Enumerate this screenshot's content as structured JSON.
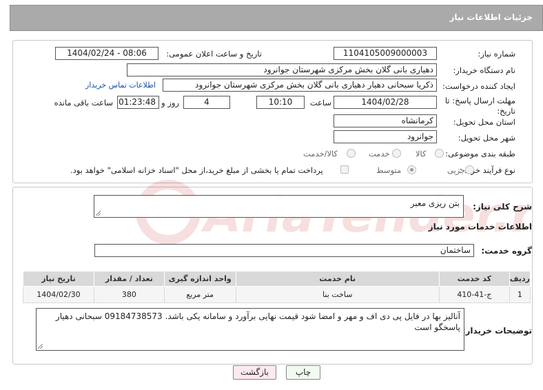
{
  "header": {
    "title": "جزئیات اطلاعات نیاز"
  },
  "labels": {
    "need_number": "شماره نیاز:",
    "announce_datetime": "تاریخ و ساعت اعلان عمومی:",
    "buyer_org": "نام دستگاه خریدار:",
    "requester": "ایجاد کننده درخواست:",
    "deadline": "مهلت ارسال پاسخ: تا تاریخ:",
    "time_word": "ساعت",
    "day_word": "روز و",
    "remaining_word": "ساعت باقی مانده",
    "province": "استان محل تحویل:",
    "city": "شهر محل تحویل:",
    "category": "طبقه بندی موضوعی:",
    "process_type": "نوع فرآیند خرید :",
    "need_desc": "شرح کلی نیاز:",
    "services_info": "اطلاعات خدمات مورد نیاز",
    "service_group": "گروه خدمت:",
    "buyer_notes": "توضیحات خریدار:"
  },
  "fields": {
    "need_number": "1104105009000003",
    "announce_datetime": "1404/02/24 - 08:06",
    "buyer_org": "دهیاری بانی گلان بخش مرکزی شهرستان جوانرود",
    "requester": "ذکریا سبحانی دهیار دهیاری بانی گلان بخش مرکزی شهرستان جوانرود",
    "contact_link": "اطلاعات تماس خریدار",
    "deadline_date": "1404/02/28",
    "deadline_time": "10:10",
    "days_left": "4",
    "time_left": "01:23:48",
    "province": "کرمانشاه",
    "city": "جوانرود",
    "need_desc": "بتن ریزی معبر",
    "service_group": "ساختمان",
    "buyer_notes": "آنالیز بها در فایل پی دی اف و مهر و امضا شود قیمت نهایی برآورد و سامانه یکی باشد. 09184738573 سبحانی دهیار پاسخگو است"
  },
  "category_options": [
    {
      "label": "کالا",
      "selected": false
    },
    {
      "label": "خدمت",
      "selected": false
    },
    {
      "label": "کالا/خدمت",
      "selected": false
    }
  ],
  "process_options": [
    {
      "label": "جزیی",
      "selected": false
    },
    {
      "label": "متوسط",
      "selected": true
    }
  ],
  "payment_note": "پرداخت تمام یا بخشی از مبلغ خرید،از محل \"اسناد خزانه اسلامی\" خواهد بود.",
  "table": {
    "headers": [
      "ردیف",
      "کد خدمت",
      "نام خدمت",
      "واحد اندازه گیری",
      "تعداد / مقدار",
      "تاریخ نیاز"
    ],
    "rows": [
      [
        "1",
        "ج-41-410",
        "ساخت بنا",
        "متر مربع",
        "380",
        "1404/02/30"
      ]
    ]
  },
  "buttons": {
    "print": "چاپ",
    "back": "بازگشت"
  },
  "watermark": "AriaTender.neT"
}
